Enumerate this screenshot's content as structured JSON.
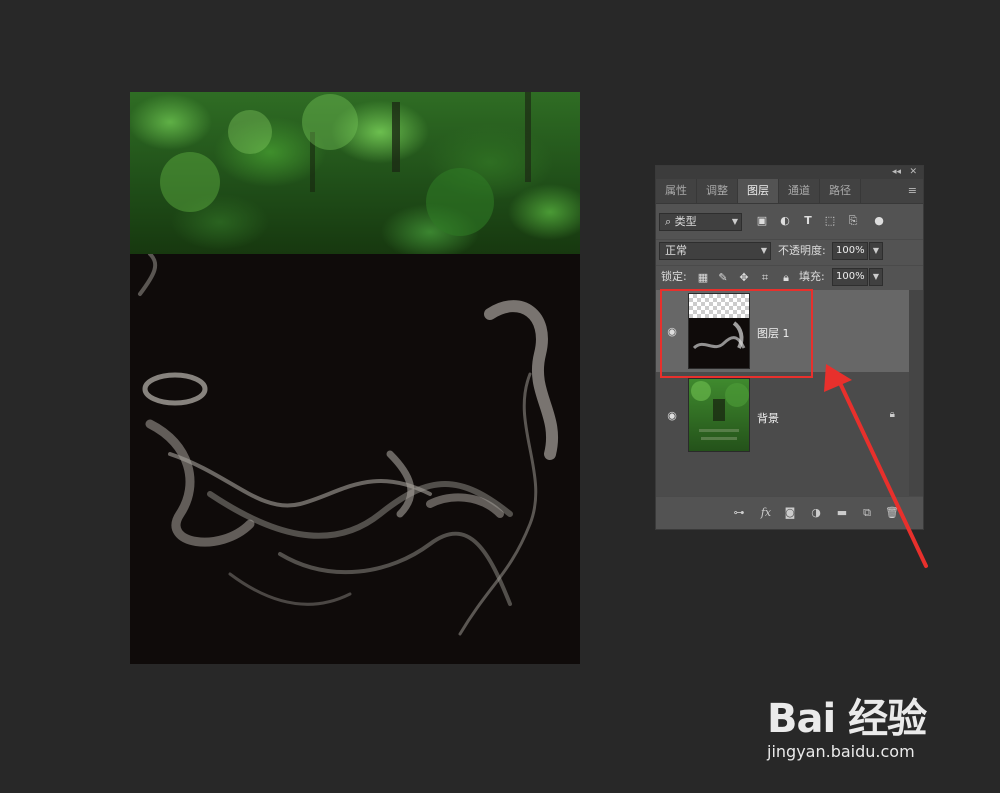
{
  "panel": {
    "tabs": [
      "属性",
      "调整",
      "图层",
      "通道",
      "路径"
    ],
    "active_tab": "图层",
    "filter_kind": "类型",
    "blend_mode": "正常",
    "opacity_label": "不透明度:",
    "opacity_value": "100%",
    "lock_label": "锁定:",
    "fill_label": "填充:",
    "fill_value": "100%",
    "layers": [
      {
        "name": "图层 1",
        "selected": true,
        "visible": true
      },
      {
        "name": "背景",
        "selected": false,
        "visible": true,
        "locked": true
      }
    ]
  },
  "watermark": {
    "logo": "Bai 经验",
    "url": "jingyan.baidu.com"
  },
  "colors": {
    "highlight": "#e8302c",
    "background": "#282828",
    "panel": "#535353"
  },
  "icons": [
    "search-icon",
    "image-filter-icon",
    "adjustment-filter-icon",
    "type-filter-icon",
    "shape-filter-icon",
    "smartobject-filter-icon",
    "eye-icon",
    "lock-icon",
    "link-icon",
    "fx-icon",
    "mask-icon",
    "adjustment-layer-icon",
    "folder-icon",
    "new-layer-icon",
    "trash-icon",
    "arrow-icon"
  ]
}
